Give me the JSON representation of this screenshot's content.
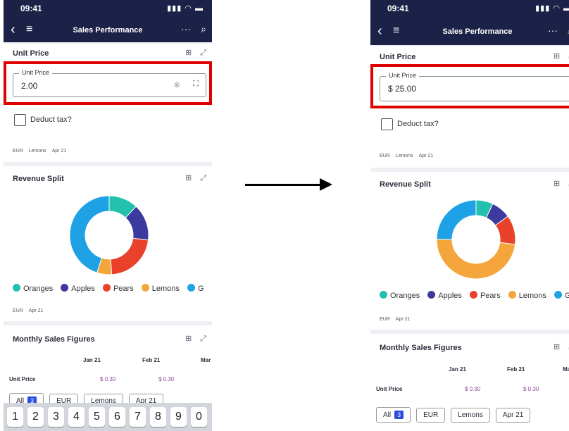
{
  "status": {
    "time": "09:41",
    "icons": "▮▮▮ ◠ ▬"
  },
  "navbar": {
    "back": "‹",
    "menu": "≡",
    "title": "Sales Performance",
    "more": "···",
    "search": "⌕"
  },
  "unit_price_card": {
    "title": "Unit Price",
    "field_label": "Unit Price",
    "before_value": "2.00",
    "after_value": "$ 25.00",
    "checkbox_label": "Deduct tax?",
    "tags": [
      "EUR",
      "Lemons",
      "Apr 21"
    ]
  },
  "revenue_card": {
    "title": "Revenue Split",
    "legend": [
      "Oranges",
      "Apples",
      "Pears",
      "Lemons",
      "G"
    ],
    "tags": [
      "EUR",
      "Apr 21"
    ]
  },
  "monthly_card": {
    "title": "Monthly Sales Figures",
    "columns": [
      "Jan 21",
      "Feb 21",
      "Mar"
    ],
    "row_label": "Unit Price",
    "row_values": [
      "$ 0.30",
      "$ 0.30"
    ]
  },
  "chips": {
    "all": "All",
    "all_count": "3",
    "currency": "EUR",
    "product": "Lemons",
    "month": "Apr 21"
  },
  "keyboard": [
    "1",
    "2",
    "3",
    "4",
    "5",
    "6",
    "7",
    "8",
    "9",
    "0"
  ],
  "colors": {
    "oranges": "#22c1ad",
    "apples": "#3c3a9e",
    "pears": "#e9412a",
    "lemons": "#f4a53c",
    "grapes": "#1fa1e6",
    "nav": "#1c2147",
    "highlight": "#e00000"
  },
  "chart_data": [
    {
      "type": "pie",
      "title": "Revenue Split",
      "categories": [
        "Oranges",
        "Apples",
        "Pears",
        "Lemons",
        "G"
      ],
      "values": [
        12,
        15,
        22,
        6,
        45
      ],
      "note_state": "before"
    },
    {
      "type": "pie",
      "title": "Revenue Split",
      "categories": [
        "Oranges",
        "Apples",
        "Pears",
        "Lemons",
        "G"
      ],
      "values": [
        7,
        8,
        12,
        48,
        25
      ],
      "note_state": "after"
    }
  ]
}
